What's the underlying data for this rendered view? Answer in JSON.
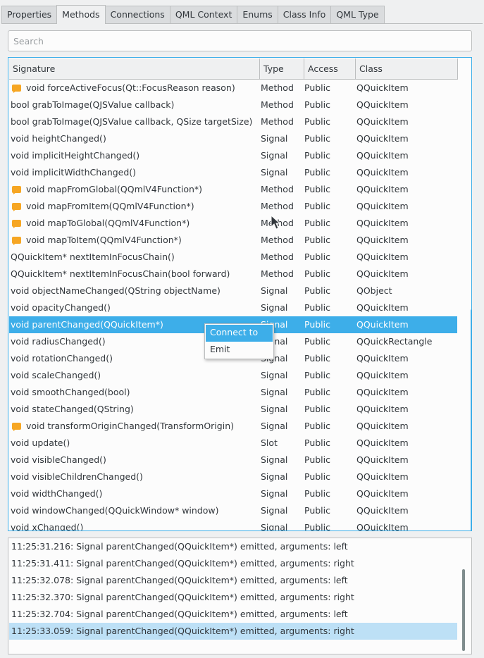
{
  "tabs": [
    {
      "label": "Properties"
    },
    {
      "label": "Methods",
      "active": true
    },
    {
      "label": "Connections"
    },
    {
      "label": "QML Context"
    },
    {
      "label": "Enums"
    },
    {
      "label": "Class Info"
    },
    {
      "label": "QML Type"
    }
  ],
  "search": {
    "placeholder": "Search",
    "value": ""
  },
  "table": {
    "columns": [
      "Signature",
      "Type",
      "Access",
      "Class"
    ],
    "rows": [
      {
        "signature": "void forceActiveFocus(Qt::FocusReason reason)",
        "type": "Method",
        "access": "Public",
        "class": "QQuickItem",
        "icon": "note-icon"
      },
      {
        "signature": "bool grabToImage(QJSValue callback)",
        "type": "Method",
        "access": "Public",
        "class": "QQuickItem",
        "icon": ""
      },
      {
        "signature": "bool grabToImage(QJSValue callback, QSize targetSize)",
        "type": "Method",
        "access": "Public",
        "class": "QQuickItem",
        "icon": ""
      },
      {
        "signature": "void heightChanged()",
        "type": "Signal",
        "access": "Public",
        "class": "QQuickItem",
        "icon": ""
      },
      {
        "signature": "void implicitHeightChanged()",
        "type": "Signal",
        "access": "Public",
        "class": "QQuickItem",
        "icon": ""
      },
      {
        "signature": "void implicitWidthChanged()",
        "type": "Signal",
        "access": "Public",
        "class": "QQuickItem",
        "icon": ""
      },
      {
        "signature": "void mapFromGlobal(QQmlV4Function*)",
        "type": "Method",
        "access": "Public",
        "class": "QQuickItem",
        "icon": "note-icon"
      },
      {
        "signature": "void mapFromItem(QQmlV4Function*)",
        "type": "Method",
        "access": "Public",
        "class": "QQuickItem",
        "icon": "note-icon"
      },
      {
        "signature": "void mapToGlobal(QQmlV4Function*)",
        "type": "Method",
        "access": "Public",
        "class": "QQuickItem",
        "icon": "note-icon"
      },
      {
        "signature": "void mapToItem(QQmlV4Function*)",
        "type": "Method",
        "access": "Public",
        "class": "QQuickItem",
        "icon": "note-icon"
      },
      {
        "signature": "QQuickItem* nextItemInFocusChain()",
        "type": "Method",
        "access": "Public",
        "class": "QQuickItem",
        "icon": ""
      },
      {
        "signature": "QQuickItem* nextItemInFocusChain(bool forward)",
        "type": "Method",
        "access": "Public",
        "class": "QQuickItem",
        "icon": ""
      },
      {
        "signature": "void objectNameChanged(QString objectName)",
        "type": "Signal",
        "access": "Public",
        "class": "QObject",
        "icon": ""
      },
      {
        "signature": "void opacityChanged()",
        "type": "Signal",
        "access": "Public",
        "class": "QQuickItem",
        "icon": ""
      },
      {
        "signature": "void parentChanged(QQuickItem*)",
        "type": "Signal",
        "access": "Public",
        "class": "QQuickItem",
        "icon": "",
        "selected": true
      },
      {
        "signature": "void radiusChanged()",
        "type": "Signal",
        "access": "Public",
        "class": "QQuickRectangle",
        "icon": ""
      },
      {
        "signature": "void rotationChanged()",
        "type": "Signal",
        "access": "Public",
        "class": "QQuickItem",
        "icon": ""
      },
      {
        "signature": "void scaleChanged()",
        "type": "Signal",
        "access": "Public",
        "class": "QQuickItem",
        "icon": ""
      },
      {
        "signature": "void smoothChanged(bool)",
        "type": "Signal",
        "access": "Public",
        "class": "QQuickItem",
        "icon": ""
      },
      {
        "signature": "void stateChanged(QString)",
        "type": "Signal",
        "access": "Public",
        "class": "QQuickItem",
        "icon": ""
      },
      {
        "signature": "void transformOriginChanged(TransformOrigin)",
        "type": "Signal",
        "access": "Public",
        "class": "QQuickItem",
        "icon": "note-icon"
      },
      {
        "signature": "void update()",
        "type": "Slot",
        "access": "Public",
        "class": "QQuickItem",
        "icon": ""
      },
      {
        "signature": "void visibleChanged()",
        "type": "Signal",
        "access": "Public",
        "class": "QQuickItem",
        "icon": ""
      },
      {
        "signature": "void visibleChildrenChanged()",
        "type": "Signal",
        "access": "Public",
        "class": "QQuickItem",
        "icon": ""
      },
      {
        "signature": "void widthChanged()",
        "type": "Signal",
        "access": "Public",
        "class": "QQuickItem",
        "icon": ""
      },
      {
        "signature": "void windowChanged(QQuickWindow* window)",
        "type": "Signal",
        "access": "Public",
        "class": "QQuickItem",
        "icon": ""
      },
      {
        "signature": "void xChanged()",
        "type": "Signal",
        "access": "Public",
        "class": "QQuickItem",
        "icon": ""
      }
    ]
  },
  "context_menu": {
    "items": [
      "Connect to",
      "Emit"
    ]
  },
  "log": {
    "lines": [
      {
        "text": "11:25:31.216: Signal parentChanged(QQuickItem*) emitted, arguments: left"
      },
      {
        "text": "11:25:31.411: Signal parentChanged(QQuickItem*) emitted, arguments: right"
      },
      {
        "text": "11:25:32.078: Signal parentChanged(QQuickItem*) emitted, arguments: left"
      },
      {
        "text": "11:25:32.370: Signal parentChanged(QQuickItem*) emitted, arguments: right"
      },
      {
        "text": "11:25:32.704: Signal parentChanged(QQuickItem*) emitted, arguments: left"
      },
      {
        "text": "11:25:33.059: Signal parentChanged(QQuickItem*) emitted, arguments: right",
        "selected": true
      }
    ]
  },
  "colors": {
    "accent": "#3daee9",
    "selection_inactive": "#bde0f6",
    "note_icon": "#f6a623",
    "background": "#eff0f1"
  }
}
